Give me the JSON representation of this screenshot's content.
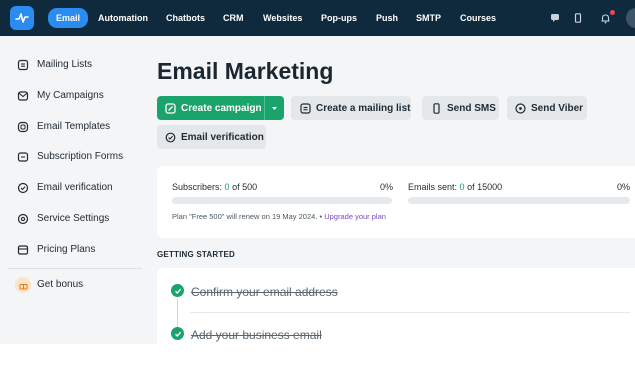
{
  "topnav": {
    "items": [
      "Email",
      "Automation",
      "Chatbots",
      "CRM",
      "Websites",
      "Pop-ups",
      "Push",
      "SMTP",
      "Courses"
    ],
    "active": "Email",
    "icons": [
      "chat-icon",
      "mobile-icon",
      "bell-icon"
    ]
  },
  "sidebar": {
    "items": [
      {
        "label": "Mailing Lists",
        "icon": "list-icon"
      },
      {
        "label": "My Campaigns",
        "icon": "campaign-icon"
      },
      {
        "label": "Email Templates",
        "icon": "template-icon"
      },
      {
        "label": "Subscription Forms",
        "icon": "form-icon"
      },
      {
        "label": "Email verification",
        "icon": "verify-icon"
      },
      {
        "label": "Service Settings",
        "icon": "settings-icon"
      },
      {
        "label": "Pricing Plans",
        "icon": "pricing-icon"
      }
    ],
    "bonus": {
      "label": "Get bonus",
      "icon": "gift-icon"
    }
  },
  "main": {
    "title": "Email Marketing",
    "actions": {
      "create_campaign": "Create campaign",
      "create_list": "Create a mailing list",
      "send_sms": "Send SMS",
      "send_viber": "Send Viber",
      "email_verification": "Email verification"
    },
    "stats": {
      "subscribers_label": "Subscribers:",
      "subscribers_value": "0",
      "subscribers_of": "of 500",
      "subscribers_pct": "0%",
      "subscribers_fraction": 0,
      "emails_label": "Emails sent:",
      "emails_value": "0",
      "emails_of": "of 15000",
      "emails_pct": "0%",
      "emails_fraction": 0,
      "plan_text": "Plan \"Free 500\" will renew on 19 May 2024. •",
      "upgrade_link": "Upgrade your plan"
    },
    "getting_started": {
      "title": "GETTING STARTED",
      "steps": [
        "Confirm your email address",
        "Add your business email"
      ]
    }
  },
  "colors": {
    "topbar": "#0f2a3d",
    "accent_blue": "#2a8cf0",
    "primary_green": "#1aa36b",
    "link_purple": "#7a49c4",
    "notification_red": "#f0455a"
  }
}
